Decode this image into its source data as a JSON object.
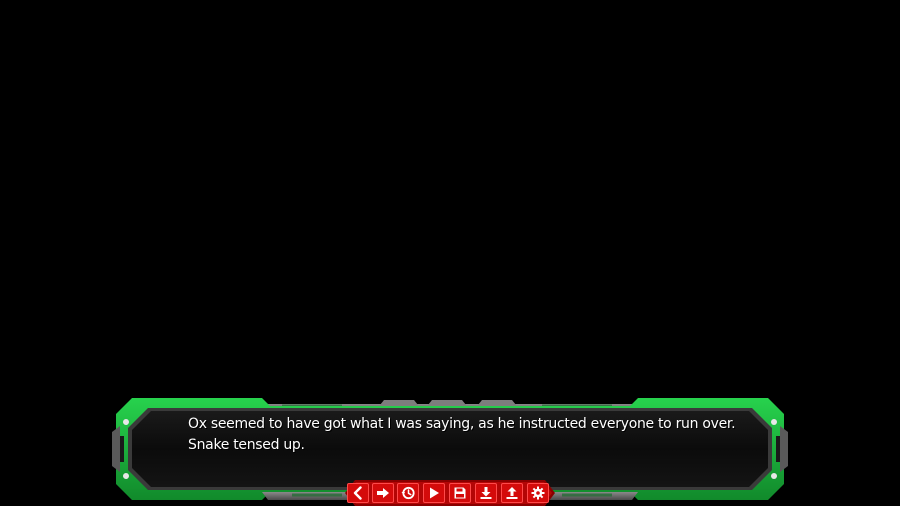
{
  "dialogue": {
    "line1": "Ox seemed to have got what I was saying, as he instructed everyone to run over.",
    "line2": "Snake tensed up."
  },
  "quick_menu": {
    "buttons": [
      {
        "id": "back",
        "icon": "chevron-left-icon"
      },
      {
        "id": "skip",
        "icon": "arrow-right-icon"
      },
      {
        "id": "history",
        "icon": "history-icon"
      },
      {
        "id": "auto",
        "icon": "play-icon"
      },
      {
        "id": "save",
        "icon": "floppy-disk-icon"
      },
      {
        "id": "load",
        "icon": "download-icon"
      },
      {
        "id": "upload",
        "icon": "upload-icon"
      },
      {
        "id": "settings",
        "icon": "gear-icon"
      }
    ]
  },
  "colors": {
    "background": "#000000",
    "frame_green": "#1db33f",
    "frame_dark": "#0d0d0d",
    "frame_gray": "#6f6f6f",
    "menu_red": "#d40b0b",
    "text": "#ffffff"
  }
}
